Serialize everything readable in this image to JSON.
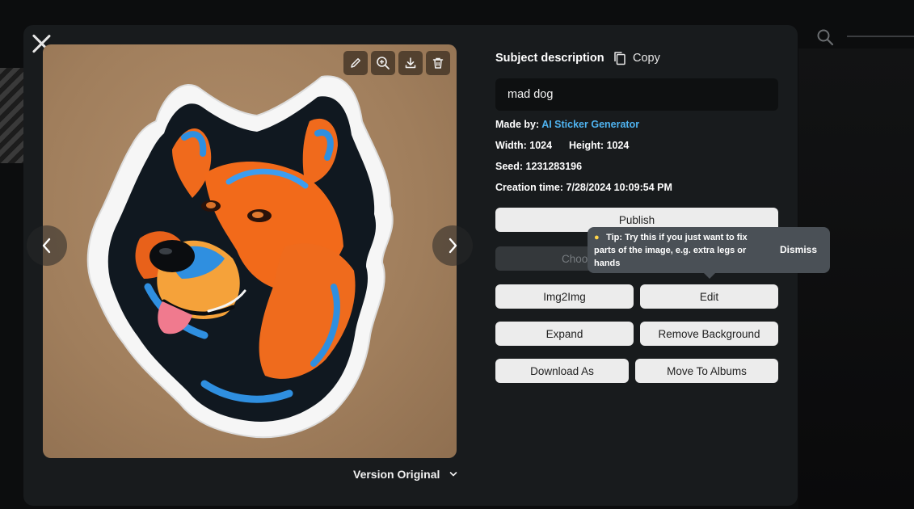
{
  "modal": {
    "panel": {
      "subject_label": "Subject description",
      "copy_label": "Copy",
      "description": "mad dog",
      "made_by_label": "Made by:",
      "made_by_value": "AI Sticker Generator",
      "width_label": "Width:",
      "width_value": "1024",
      "height_label": "Height:",
      "height_value": "1024",
      "seed_label": "Seed:",
      "seed_value": "1231283196",
      "creation_label": "Creation time:",
      "creation_value": "7/28/2024 10:09:54 PM"
    },
    "buttons": {
      "publish": "Publish",
      "choose_partial": "Choo",
      "img2img": "Img2Img",
      "edit": "Edit",
      "expand": "Expand",
      "remove_background": "Remove Background",
      "download_as": "Download As",
      "move_to_albums": "Move To Albums"
    },
    "tooltip": {
      "text": "Tip: Try this if you just want to fix parts of the image, e.g. extra legs or hands",
      "dismiss": "Dismiss"
    },
    "version_label": "Version Original",
    "image_tools": [
      "pencil-icon",
      "zoom-in-icon",
      "download-icon",
      "trash-icon"
    ]
  },
  "colors": {
    "accent_link": "#4fb3f0",
    "modal_bg": "#181b1d",
    "button_bg": "#ececec",
    "tooltip_bg": "#4a5056"
  }
}
